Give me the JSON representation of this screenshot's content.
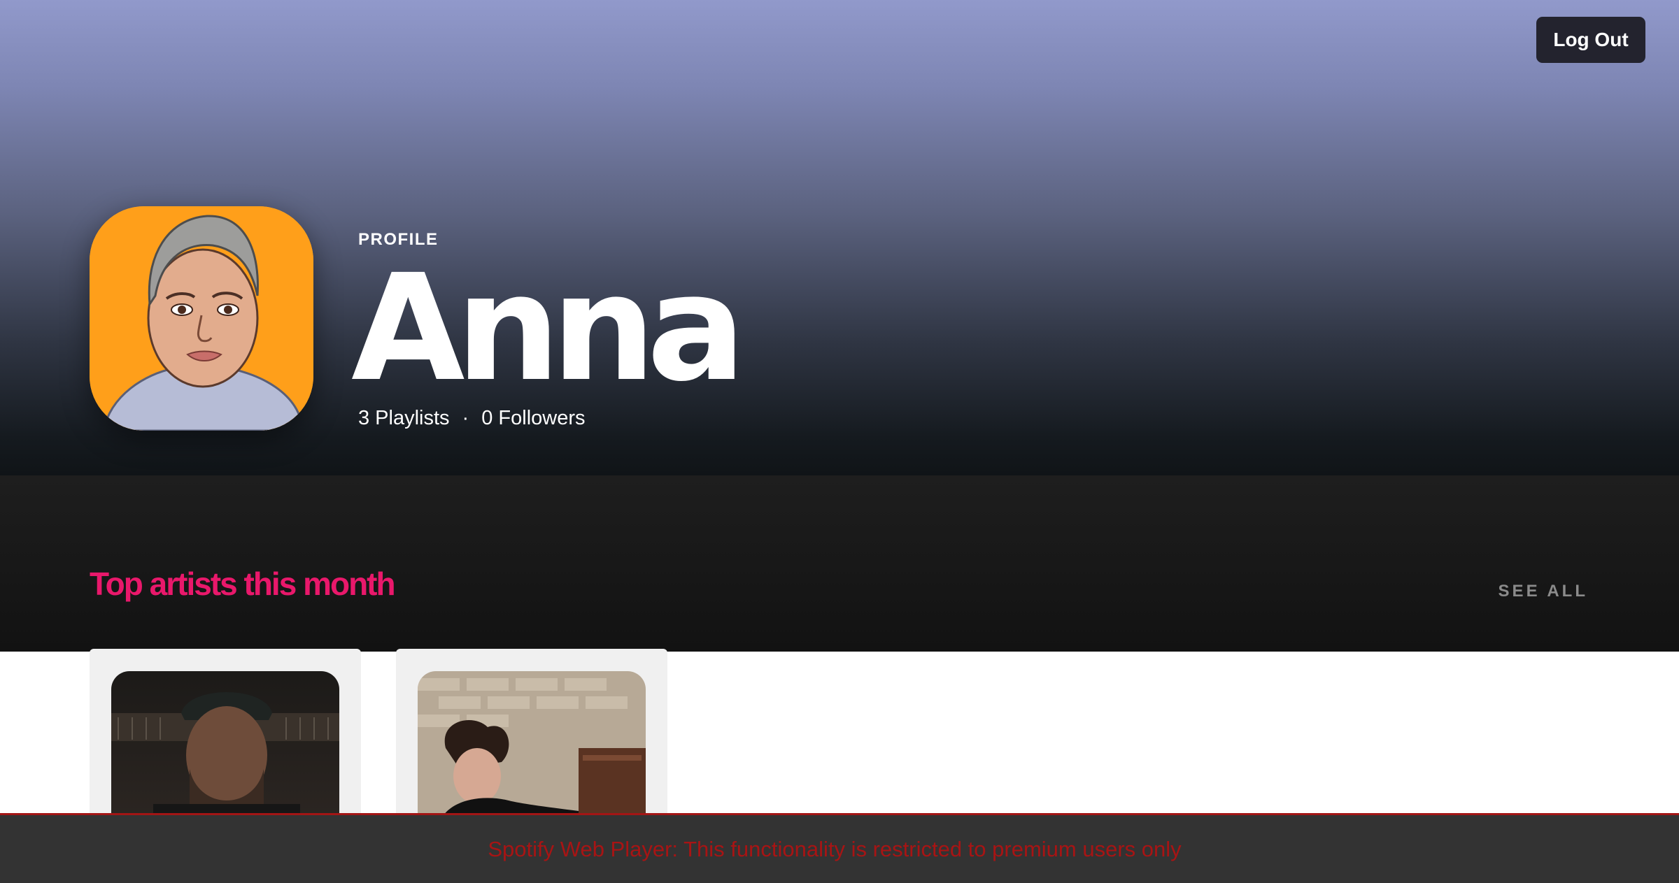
{
  "header": {
    "logout_label": "Log Out"
  },
  "profile": {
    "kicker": "PROFILE",
    "name": "Anna",
    "playlists": "3 Playlists",
    "separator": "·",
    "followers": "0 Followers"
  },
  "top_artists": {
    "title": "Top artists this month",
    "see_all_label": "SEE ALL",
    "cards": [
      {
        "image": "artist-photo-man-with-cap"
      },
      {
        "image": "artist-photo-curly-hair"
      }
    ]
  },
  "notice": {
    "text": "Spotify Web Player: This functionality is restricted to premium users only"
  },
  "colors": {
    "accent": "#e9186b",
    "avatar_background": "#ff9f1a",
    "notice_text": "#a81414"
  }
}
